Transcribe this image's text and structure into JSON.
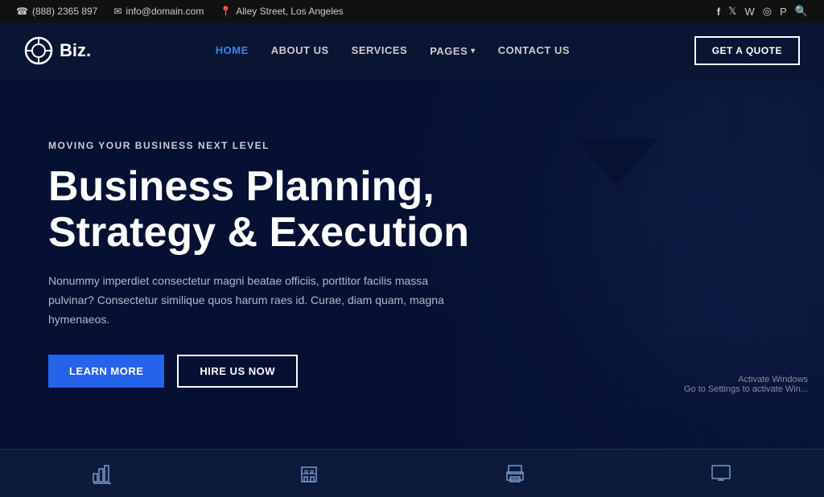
{
  "topbar": {
    "phone": "(888) 2365 897",
    "email": "info@domain.com",
    "address": "Alley Street, Los Angeles",
    "phone_icon": "☎",
    "email_icon": "✉",
    "location_icon": "📍"
  },
  "social": [
    {
      "name": "facebook",
      "icon": "f"
    },
    {
      "name": "twitter",
      "icon": "t"
    },
    {
      "name": "whatsapp",
      "icon": "w"
    },
    {
      "name": "instagram",
      "icon": "i"
    },
    {
      "name": "pinterest",
      "icon": "p"
    },
    {
      "name": "search",
      "icon": "🔍"
    }
  ],
  "navbar": {
    "logo_text": "Biz.",
    "nav_items": [
      {
        "label": "HOME",
        "active": true
      },
      {
        "label": "ABOUT US",
        "active": false
      },
      {
        "label": "SERVICES",
        "active": false
      },
      {
        "label": "PAGES",
        "active": false,
        "dropdown": true
      },
      {
        "label": "CONTACT US",
        "active": false
      }
    ],
    "cta_label": "GET A QUOTE"
  },
  "hero": {
    "subtitle": "MOVING YOUR BUSINESS NEXT LEVEL",
    "title_line1": "Business Planning,",
    "title_line2": "Strategy & Execution",
    "description": "Nonummy imperdiet consectetur magni beatae officiis, porttitor facilis massa pulvinar? Consectetur similique quos harum raes id. Curae, diam quam, magna hymenaeos.",
    "btn_primary": "LEARN MORE",
    "btn_secondary": "HIRE US NOW"
  },
  "activate_windows": {
    "line1": "Activate Windows",
    "line2": "Go to Settings to activate Win..."
  },
  "bottom_icons": [
    {
      "name": "chart-icon"
    },
    {
      "name": "building-icon"
    },
    {
      "name": "printer-icon"
    },
    {
      "name": "monitor-icon"
    }
  ]
}
